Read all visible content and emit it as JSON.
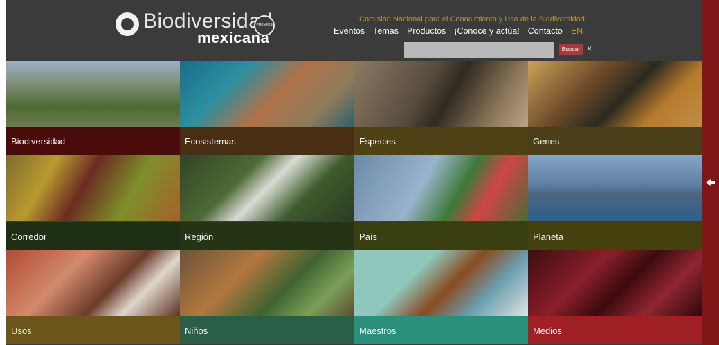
{
  "header": {
    "logo_title": "Biodiversidad",
    "logo_subtitle": "mexicana",
    "badge_text": "PREMIOS",
    "commission": "Comisión Nacional para el Conocimiento y Uso de la Biodiversidad",
    "nav": {
      "eventos": "Eventos",
      "temas": "Temas",
      "productos": "Productos",
      "conoce": "¡Conoce y actúa!",
      "contacto": "Contacto",
      "lang": "EN"
    },
    "search": {
      "value": "",
      "button": "Buscar",
      "close": "×"
    }
  },
  "tiles": [
    {
      "label": "Biodiversidad",
      "color": "#4a0b0b"
    },
    {
      "label": "Ecosistemas",
      "color": "#4a2e14"
    },
    {
      "label": "Especies",
      "color": "#4f4015"
    },
    {
      "label": "Genes",
      "color": "#4a3f18"
    },
    {
      "label": "Corredor",
      "color": "#1f2f14"
    },
    {
      "label": "Región",
      "color": "#253414"
    },
    {
      "label": "País",
      "color": "#3a3f12"
    },
    {
      "label": "Planeta",
      "color": "#44410f"
    },
    {
      "label": "Usos",
      "color": "#6c5519"
    },
    {
      "label": "Niños",
      "color": "#2a5e46"
    },
    {
      "label": "Maestros",
      "color": "#2a907b"
    },
    {
      "label": "Medios",
      "color": "#a01f22"
    }
  ],
  "side_panel": {
    "color": "#7f1617",
    "icon": "arrow-left-icon"
  }
}
